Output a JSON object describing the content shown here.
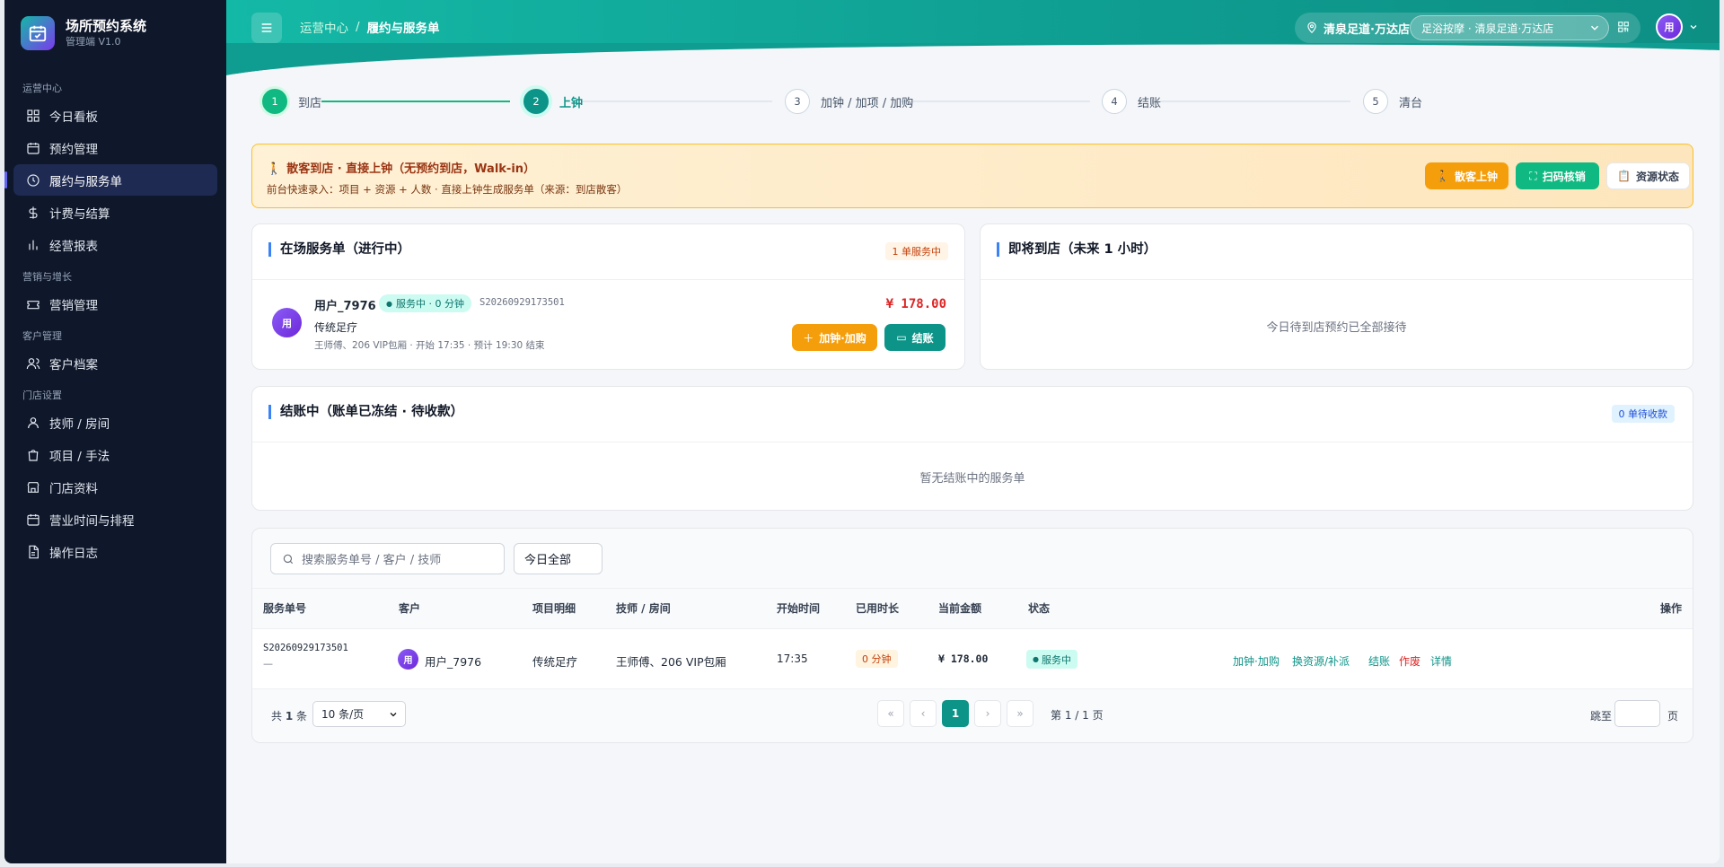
{
  "brand": {
    "title": "场所预约系统",
    "subtitle": "管理端 V1.0"
  },
  "sidebar": {
    "groups": [
      {
        "label": "运营中心",
        "items": [
          {
            "label": "今日看板",
            "icon": "dashboard-icon"
          },
          {
            "label": "预约管理",
            "icon": "calendar-icon"
          },
          {
            "label": "履约与服务单",
            "icon": "clock-icon",
            "active": true
          },
          {
            "label": "计费与结算",
            "icon": "dollar-icon"
          },
          {
            "label": "经营报表",
            "icon": "bar-chart-icon"
          }
        ]
      },
      {
        "label": "营销与增长",
        "items": [
          {
            "label": "营销管理",
            "icon": "ticket-icon"
          }
        ]
      },
      {
        "label": "客户管理",
        "items": [
          {
            "label": "客户档案",
            "icon": "users-icon"
          }
        ]
      },
      {
        "label": "门店设置",
        "items": [
          {
            "label": "技师 / 房间",
            "icon": "user-icon"
          },
          {
            "label": "项目 / 手法",
            "icon": "bag-icon"
          },
          {
            "label": "门店资料",
            "icon": "store-icon"
          },
          {
            "label": "营业时间与排程",
            "icon": "calendar-icon"
          },
          {
            "label": "操作日志",
            "icon": "file-icon"
          }
        ]
      }
    ]
  },
  "header": {
    "breadcrumb": [
      "运营中心",
      "履约与服务单"
    ],
    "store_name": "清泉足道·万达店",
    "store_select": "足浴按摩 · 清泉足道·万达店",
    "avatar": "用"
  },
  "steps": [
    {
      "num": "1",
      "label": "到店",
      "state": "done"
    },
    {
      "num": "2",
      "label": "上钟",
      "state": "current"
    },
    {
      "num": "3",
      "label": "加钟 / 加项 / 加购",
      "state": "todo"
    },
    {
      "num": "4",
      "label": "结账",
      "state": "todo"
    },
    {
      "num": "5",
      "label": "清台",
      "state": "todo"
    }
  ],
  "banner": {
    "title": "散客到店 · 直接上钟（无预约到店，Walk-in）",
    "subtitle": "前台快速录入：项目 + 资源 + 人数 · 直接上钟生成服务单（来源：到店散客）",
    "buttons": {
      "walkin": "散客上钟",
      "scan": "扫码核销",
      "resource": "资源状态"
    }
  },
  "active_orders": {
    "title": "在场服务单（进行中）",
    "badge": "1 单服务中",
    "order": {
      "avatar": "用",
      "customer": "用户_7976",
      "status": "服务中 · 0 分钟",
      "order_no": "S20260929173501",
      "amount": "¥ 178.00",
      "service": "传统足疗",
      "detail": "王师傅、206 VIP包厢 · 开始 17:35 · 预计 19:30 结束",
      "add_label": "加钟·加购",
      "checkout_label": "结账"
    }
  },
  "upcoming": {
    "title": "即将到店（未来 1 小时）",
    "empty": "今日待到店预约已全部接待"
  },
  "checkout": {
    "title": "结账中（账单已冻结 · 待收款）",
    "badge": "0 单待收款",
    "empty": "暂无结账中的服务单"
  },
  "table": {
    "search_placeholder": "搜索服务单号 / 客户 / 技师",
    "filter": "今日全部",
    "headers": [
      "服务单号",
      "客户",
      "项目明细",
      "技师 / 房间",
      "开始时间",
      "已用时长",
      "当前金额",
      "状态",
      "操作"
    ],
    "rows": [
      {
        "order_no": "S20260929173501",
        "order_sub": "—",
        "avatar": "用",
        "customer": "用户_7976",
        "item": "传统足疗",
        "tech_room": "王师傅、206 VIP包厢",
        "start": "17:35",
        "duration": "0 分钟",
        "amount": "¥ 178.00",
        "status": "服务中",
        "ops": [
          "加钟·加购",
          "换资源/补派",
          "结账",
          "作废",
          "详情"
        ]
      }
    ],
    "total_prefix": "共",
    "total_count": "1",
    "total_suffix": "条",
    "page_size": "10 条/页",
    "current_page": "1",
    "page_info": "第 1 / 1 页",
    "jump_label": "跳至",
    "jump_suffix": "页"
  },
  "colors": {
    "accent": "#0d9488",
    "success": "#10b981",
    "warning": "#f59e0b",
    "danger": "#dc2626",
    "sidebar": "#0f172a"
  }
}
